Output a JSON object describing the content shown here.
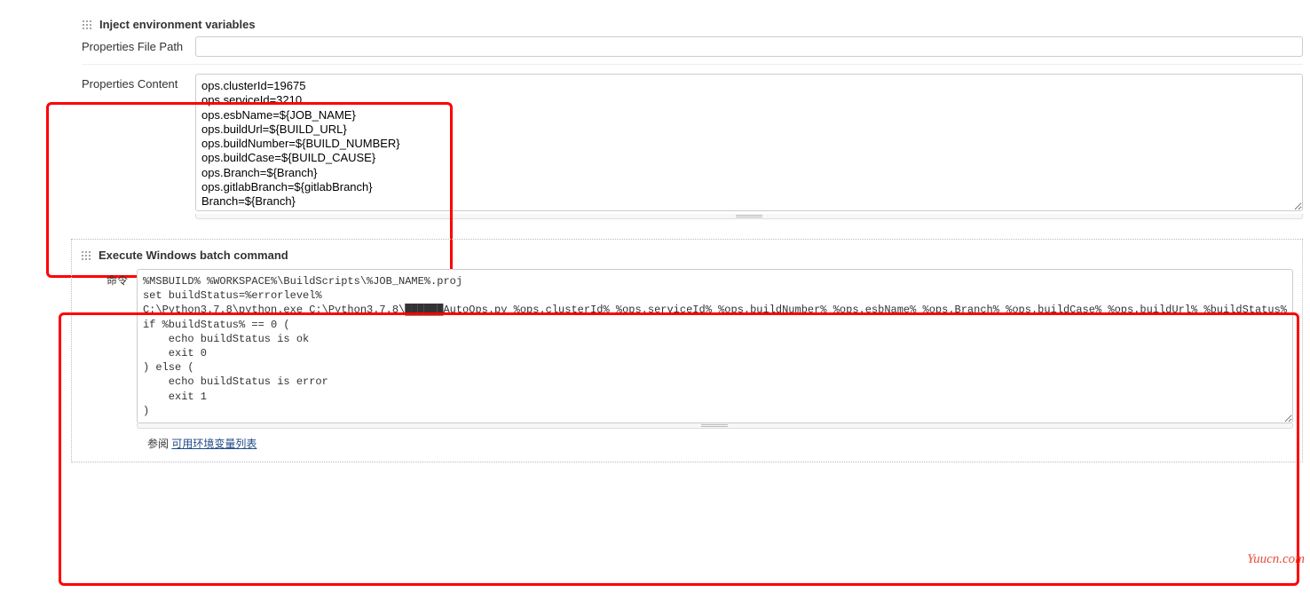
{
  "section1": {
    "title": "Inject environment variables",
    "filePath": {
      "label": "Properties File Path",
      "value": ""
    },
    "content": {
      "label": "Properties Content",
      "value": "ops.clusterId=19675\nops.serviceId=3210\nops.esbName=${JOB_NAME}\nops.buildUrl=${BUILD_URL}\nops.buildNumber=${BUILD_NUMBER}\nops.buildCase=${BUILD_CAUSE}\nops.Branch=${Branch}\nops.gitlabBranch=${gitlabBranch}\nBranch=${Branch}"
    }
  },
  "section2": {
    "title": "Execute Windows batch command",
    "commandLabel": "命令",
    "commandValue": "%MSBUILD% %WORKSPACE%\\BuildScripts\\%JOB_NAME%.proj\nset buildStatus=%errorlevel%\nC:\\Python3.7.8\\python.exe C:\\Python3.7.8\\██████AutoOps.py %ops.clusterId% %ops.serviceId% %ops.buildNumber% %ops.esbName% %ops.Branch% %ops.buildCase% %ops.buildUrl% %buildStatus%\nif %buildStatus% == 0 (\n    echo buildStatus is ok\n    exit 0\n) else (\n    echo buildStatus is error\n    exit 1\n)",
    "refText": "参阅 ",
    "refLink": "可用环境变量列表"
  },
  "watermark": "Yuucn.com"
}
